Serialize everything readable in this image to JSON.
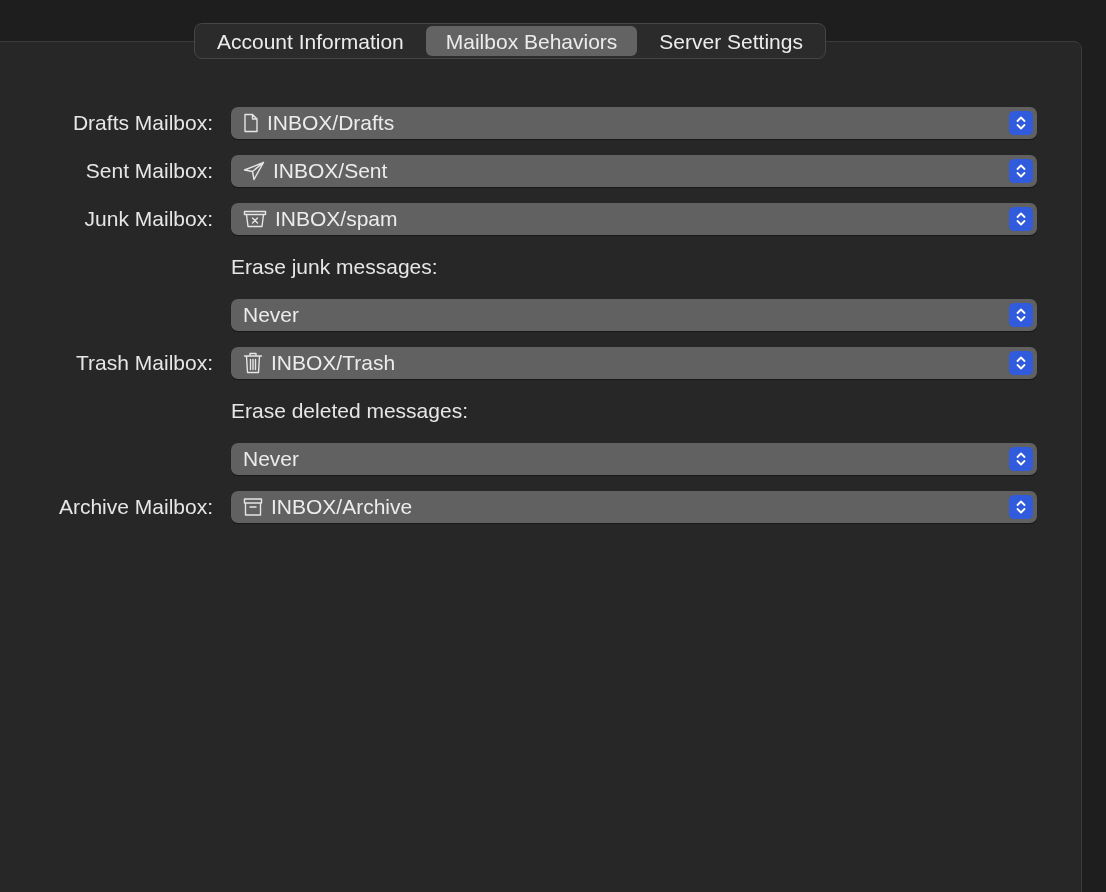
{
  "tabs": [
    {
      "label": "Account Information",
      "selected": false
    },
    {
      "label": "Mailbox Behaviors",
      "selected": true
    },
    {
      "label": "Server Settings",
      "selected": false
    }
  ],
  "rows": [
    {
      "kind": "mailbox",
      "label": "Drafts Mailbox:",
      "value": "INBOX/Drafts"
    },
    {
      "kind": "mailbox",
      "label": "Sent Mailbox:",
      "value": "INBOX/Sent"
    },
    {
      "kind": "mailbox",
      "label": "Junk Mailbox:",
      "value": "INBOX/spam"
    },
    {
      "kind": "caption",
      "text": "Erase junk messages:"
    },
    {
      "kind": "option",
      "value": "Never"
    },
    {
      "kind": "mailbox",
      "label": "Trash Mailbox:",
      "value": "INBOX/Trash"
    },
    {
      "kind": "caption",
      "text": "Erase deleted messages:"
    },
    {
      "kind": "option",
      "value": "Never"
    },
    {
      "kind": "mailbox",
      "label": "Archive Mailbox:",
      "value": "INBOX/Archive"
    }
  ]
}
